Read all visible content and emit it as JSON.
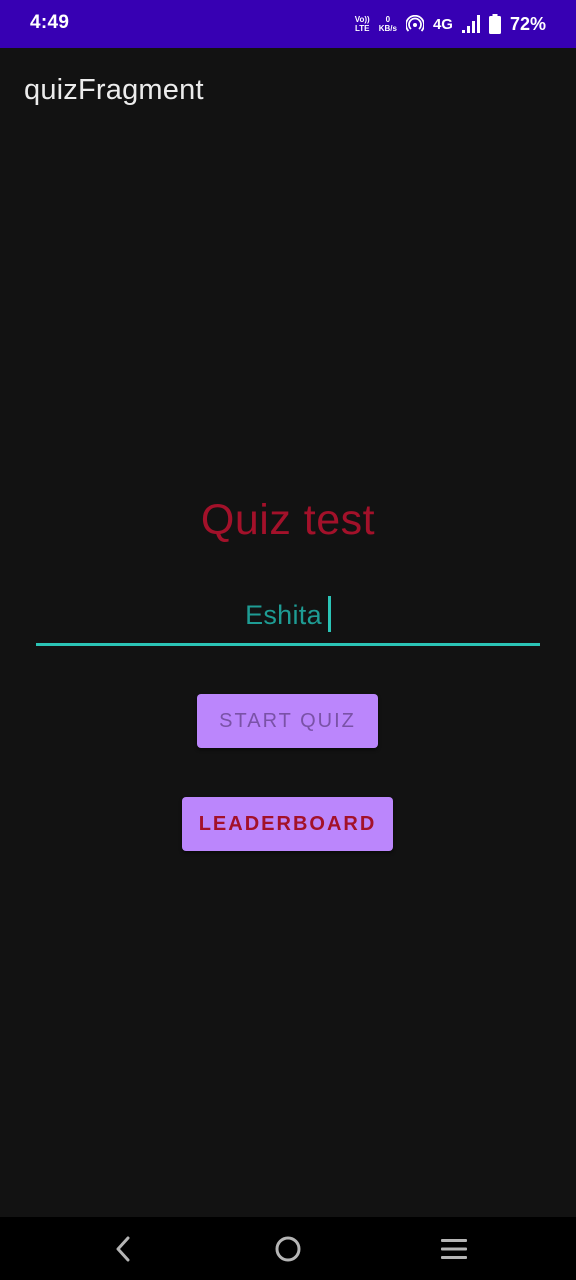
{
  "status_bar": {
    "time": "4:49",
    "volte_top": "Vo))",
    "volte_bottom": "LTE",
    "speed_value": "0",
    "speed_unit": "KB/s",
    "network": "4G",
    "battery_percent": "72%",
    "color": "#3700B3"
  },
  "app_bar": {
    "title": "quizFragment"
  },
  "main": {
    "heading": "Quiz test",
    "name_input_value": "Eshita",
    "start_button_label": "START QUIZ",
    "leaderboard_button_label": "LEADERBOARD"
  },
  "nav_bar": {
    "icons": [
      "back-icon",
      "home-icon",
      "recents-menu-icon"
    ]
  },
  "colors": {
    "background": "#121212",
    "accent_purple": "#BB86FC",
    "heading_red": "#A3112A",
    "input_teal": "#2BC4B6"
  }
}
